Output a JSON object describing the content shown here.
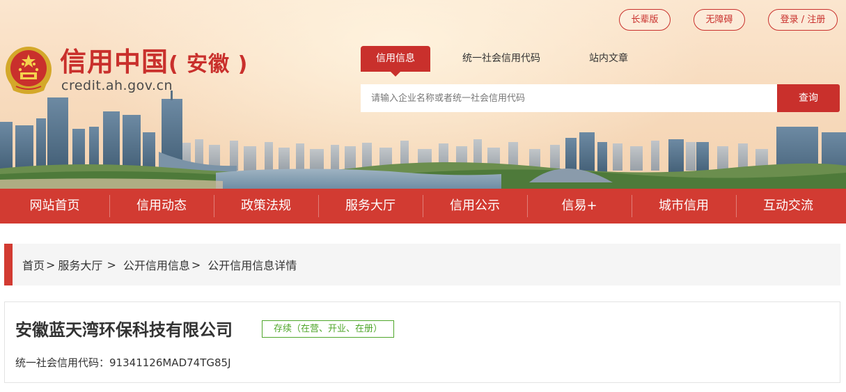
{
  "top_links": {
    "elder": "长辈版",
    "accessibility": "无障碍",
    "login": "登录 / 注册"
  },
  "logo": {
    "title_main": "信用中国",
    "title_region": "( 安徽 )",
    "domain": "credit.ah.gov.cn"
  },
  "search": {
    "tabs": [
      {
        "label": "信用信息",
        "active": true
      },
      {
        "label": "统一社会信用代码",
        "active": false
      },
      {
        "label": "站内文章",
        "active": false
      }
    ],
    "placeholder": "请输入企业名称或者统一社会信用代码",
    "button_label": "查询"
  },
  "nav": {
    "items": [
      "网站首页",
      "信用动态",
      "政策法规",
      "服务大厅",
      "信用公示",
      "信易+",
      "城市信用",
      "互动交流"
    ]
  },
  "breadcrumb": {
    "items": [
      "首页",
      "服务大厅",
      "公开信用信息",
      "公开信用信息详情"
    ],
    "separator": ">"
  },
  "company": {
    "name": "安徽蓝天湾环保科技有限公司",
    "status": "存续（在营、开业、在册）",
    "credit_code_label": "统一社会信用代码：",
    "credit_code": "91341126MAD74TG85J"
  },
  "colors": {
    "primary_red": "#c9302c",
    "nav_red": "#d23b32",
    "status_green": "#4fa62a"
  }
}
